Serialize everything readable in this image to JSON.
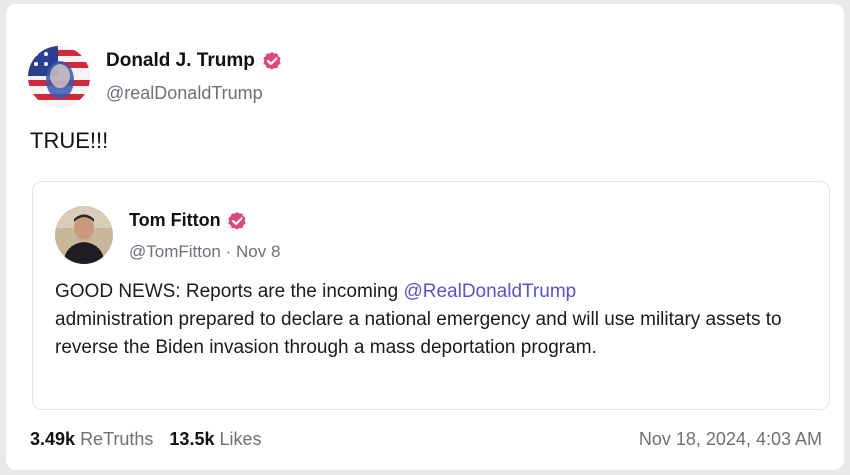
{
  "post": {
    "author_name": "Donald J. Trump",
    "author_handle": "@realDonaldTrump",
    "text": "TRUE!!!",
    "verified_color": "#e2457a"
  },
  "quote": {
    "author_name": "Tom Fitton",
    "author_handle": "@TomFitton",
    "separator": "·",
    "date": "Nov 8",
    "text_before": "GOOD NEWS: Reports are the incoming ",
    "mention": "@RealDonaldTrump",
    "text_after": " administration prepared to declare a national emergency and will use military assets to reverse the Biden invasion through a mass deportation program."
  },
  "stats": {
    "retruths_count": "3.49k",
    "retruths_label": "ReTruths",
    "likes_count": "13.5k",
    "likes_label": "Likes"
  },
  "timestamp": "Nov 18, 2024, 4:03 AM"
}
